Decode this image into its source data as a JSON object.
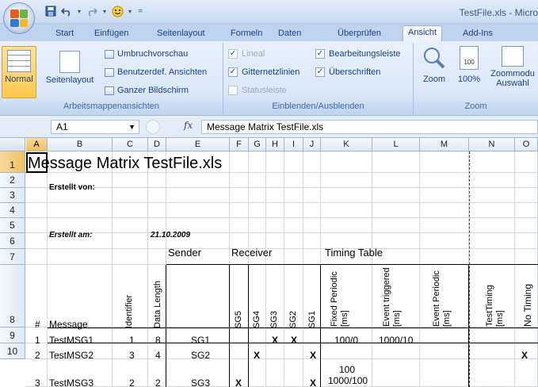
{
  "window": {
    "title": "TestFile.xls - Micro"
  },
  "tabs": [
    "Start",
    "Einfügen",
    "Seitenlayout",
    "Formeln",
    "Daten",
    "Überprüfen",
    "Ansicht",
    "Add-Ins"
  ],
  "active_tab": "Ansicht",
  "ribbon": {
    "workbook_views": {
      "normal": "Normal",
      "page_layout": "Seitenlayout",
      "page_break_preview": "Umbruchvorschau",
      "custom_views": "Benutzerdef. Ansichten",
      "full_screen": "Ganzer Bildschirm",
      "group_label": "Arbeitsmappenansichten"
    },
    "show_hide": {
      "ruler": "Lineal",
      "gridlines": "Gitternetzlinien",
      "message_bar": "Statusleiste",
      "formula_bar": "Bearbeitungsleiste",
      "headings": "Überschriften",
      "group_label": "Einblenden/Ausblenden",
      "ruler_checked": false,
      "gridlines_checked": true,
      "message_bar_checked": false,
      "formula_bar_checked": true,
      "headings_checked": true
    },
    "zoom": {
      "zoom": "Zoom",
      "hundred": "100%",
      "zoom_selection_1": "Zoommodu",
      "zoom_selection_2": "Auswahl",
      "hundred_icon_text": "100",
      "group_label": "Zoom"
    }
  },
  "formula_bar": {
    "name_box": "A1",
    "fx": "fx",
    "content": "Message Matrix TestFile.xls"
  },
  "columns": [
    "A",
    "B",
    "C",
    "D",
    "E",
    "F",
    "G",
    "H",
    "I",
    "J",
    "K",
    "L",
    "M",
    "N",
    "O"
  ],
  "rows": [
    "1",
    "2",
    "3",
    "4",
    "5",
    "6",
    "7",
    "8",
    "9",
    "10"
  ],
  "sheet": {
    "title": "Message Matrix TestFile.xls",
    "created_by": "Erstellt von:",
    "created_on": "Erstellt am:",
    "date": "21.10.2009",
    "sender": "Sender",
    "receiver": "Receiver",
    "timing_table": "Timing Table",
    "h_num": "#",
    "h_message": "Message",
    "h_identifier": "Identifier",
    "h_data_length": "Data Length",
    "h_receivers": [
      "SG5",
      "SG4",
      "SG3",
      "SG2",
      "SG1"
    ],
    "h_fixed_1": "Fixed Periodic",
    "h_fixed_2": "[ms]",
    "h_event_1": "Event triggered",
    "h_event_2": "[ms]",
    "h_eperiodic_1": "Event Periodic",
    "h_eperiodic_2": "[ms]",
    "h_testtiming_1": "TestTiming",
    "h_testtiming_2": "[ms]",
    "h_notiming": "No Timing",
    "data_rows": [
      {
        "num": "1",
        "message": "TestMSG1",
        "identifier": "1",
        "length": "8",
        "sender": "SG1",
        "marks": [
          "",
          "",
          "X",
          "X",
          ""
        ],
        "fixed": "100/0",
        "event": "1000/10",
        "notiming": ""
      },
      {
        "num": "2",
        "message": "TestMSG2",
        "identifier": "3",
        "length": "4",
        "sender": "SG2",
        "marks": [
          "",
          "X",
          "",
          "",
          "X"
        ],
        "fixed": "",
        "event": "",
        "notiming": "X"
      },
      {
        "num": "3",
        "message": "TestMSG3",
        "identifier": "2",
        "length": "2",
        "sender": "SG3",
        "marks": [
          "X",
          "",
          "",
          "",
          "X"
        ],
        "fixed_1": "100",
        "fixed_2": "1000/100",
        "event": "",
        "notiming": ""
      }
    ]
  }
}
